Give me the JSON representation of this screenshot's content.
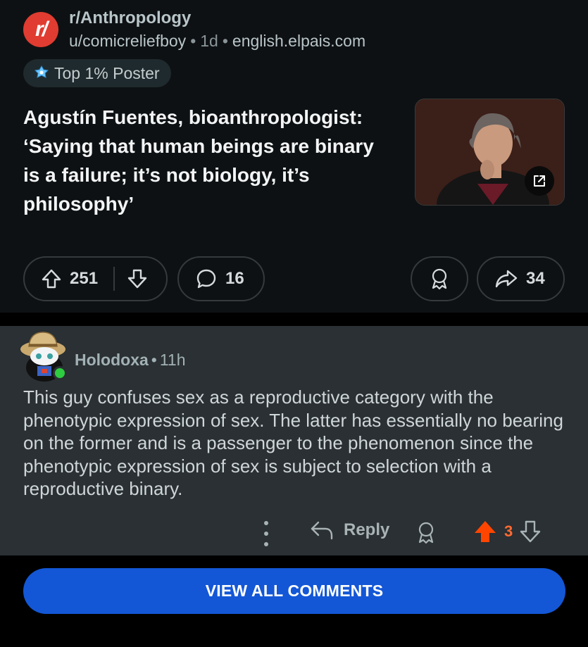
{
  "post": {
    "subreddit": "r/Anthropology",
    "subreddit_icon_text": "r/",
    "author": "u/comicreliefboy",
    "age": "1d",
    "domain": "english.elpais.com",
    "badge": "Top 1% Poster",
    "title": "Agustín Fuentes, bioanthropologist: ‘Saying that human beings are binary is a failure; it’s not biology, it’s philosophy’",
    "upvotes": "251",
    "comments": "16",
    "shares": "34"
  },
  "comment": {
    "author": "Holodoxa",
    "age": "11h",
    "body": "This guy confuses sex as a reproductive category with the phenotypic expression of sex. The latter has essentially no bearing on the former and is a passenger to the phenomenon since the phenotypic expression of sex is subject to selection with a reproductive binary.",
    "reply_label": "Reply",
    "votes": "3"
  },
  "footer": {
    "view_all_label": "VIEW ALL COMMENTS"
  },
  "colors": {
    "subreddit_icon": "#e03c31",
    "upvoted": "#ff4500",
    "primary_button": "#1357d6"
  }
}
